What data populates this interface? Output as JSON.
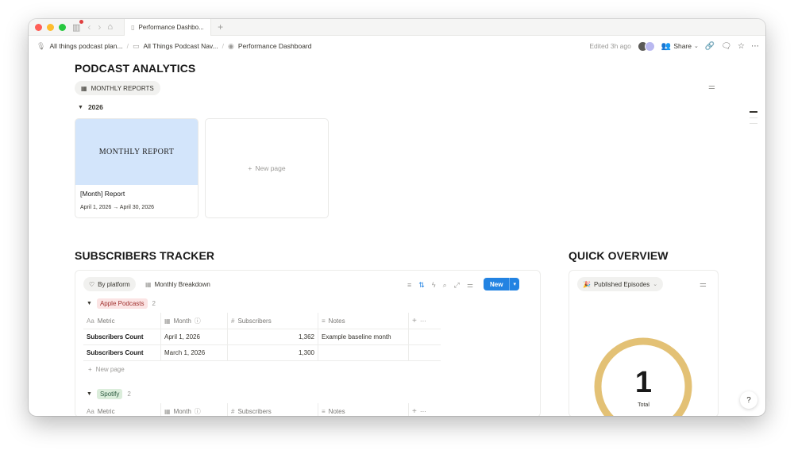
{
  "window": {
    "tab_title": "Performance Dashbo...",
    "new_tab": "+"
  },
  "breadcrumb": {
    "items": [
      "All things podcast plan...",
      "All Things Podcast Nav...",
      "Performance Dashboard"
    ],
    "edited": "Edited 3h ago",
    "share_label": "Share"
  },
  "page": {
    "title": "PODCAST ANALYTICS",
    "view_pill": "MONTHLY REPORTS",
    "group_2026": "2026",
    "card": {
      "cover_text": "MONTHLY REPORT",
      "title": "[Month] Report",
      "date": "April 1, 2026 → April 30, 2026"
    },
    "new_page": "New page"
  },
  "subscribers": {
    "title": "SUBSCRIBERS TRACKER",
    "views": [
      "By platform",
      "Monthly Breakdown"
    ],
    "new_button": "New",
    "columns": [
      "Metric",
      "Month",
      "Subscribers",
      "Notes"
    ],
    "groups": [
      {
        "name": "Apple Podcasts",
        "count": "2",
        "rows": [
          {
            "metric": "Subscribers Count",
            "month": "April 1, 2026",
            "subscribers": "1,362",
            "notes": "Example baseline month"
          },
          {
            "metric": "Subscribers Count",
            "month": "March 1, 2026",
            "subscribers": "1,300",
            "notes": ""
          }
        ]
      },
      {
        "name": "Spotify",
        "count": "2",
        "rows": []
      }
    ],
    "new_page": "New page"
  },
  "overview": {
    "title": "QUICK OVERVIEW",
    "view_label": "Published Episodes",
    "value": "1",
    "value_label": "Total",
    "ring_color": "#e3c175"
  },
  "colors": {
    "accent": "#2383e2",
    "card_cover": "#d3e5fb",
    "apple_tag": "#fbe4e4",
    "spotify_tag": "#dbeddb"
  }
}
